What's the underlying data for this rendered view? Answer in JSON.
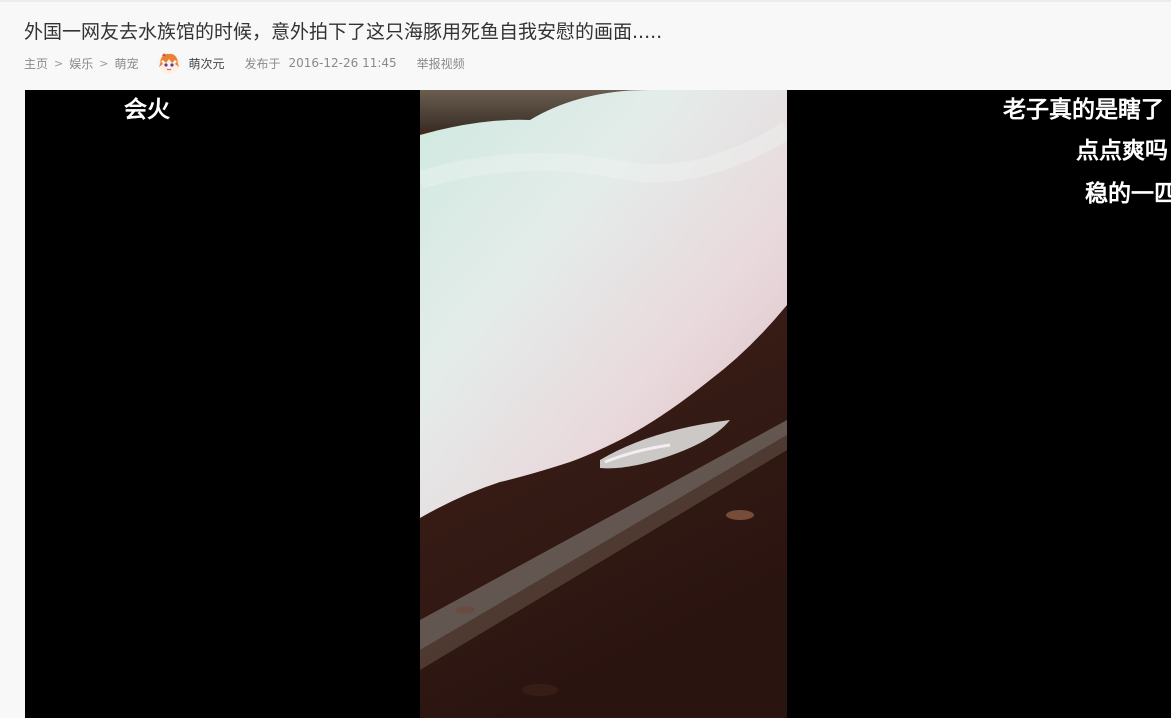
{
  "article": {
    "title": "外国一网友去水族馆的时候，意外拍下了这只海豚用死鱼自我安慰的画面....."
  },
  "breadcrumb": {
    "items": [
      "主页",
      "娱乐",
      "萌宠"
    ],
    "separator": ">"
  },
  "author": {
    "name": "萌次元",
    "avatar_icon": "anime-avatar-icon"
  },
  "publish": {
    "label": "发布于",
    "datetime": "2016-12-26  11:45"
  },
  "actions": {
    "report_label": "举报视频"
  },
  "video": {
    "captions": {
      "left": "会火",
      "right_line1": "老子真的是瞎了",
      "right_line2": "点点爽吗",
      "right_line3": "稳的一匹"
    }
  },
  "colors": {
    "background": "#f8f8f8",
    "title_text": "#333333",
    "meta_text": "#8a8a8a",
    "player_bg": "#000000",
    "caption_text": "#ffffff"
  }
}
